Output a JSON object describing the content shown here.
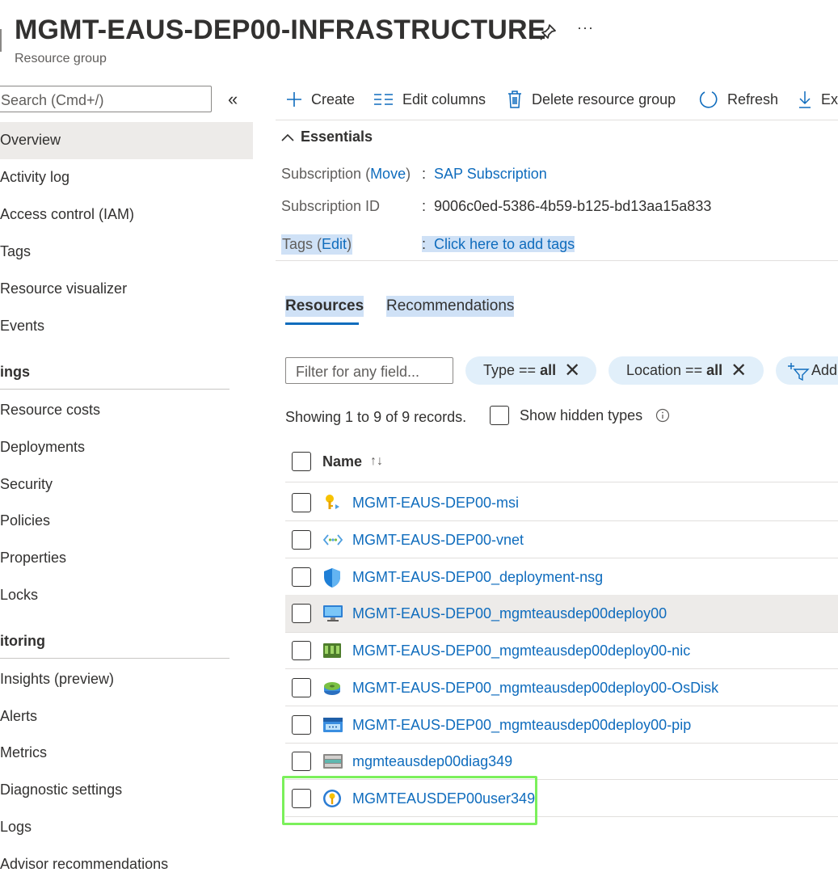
{
  "header": {
    "title": "MGMT-EAUS-DEP00-INFRASTRUCTURE",
    "subtitle": "Resource group",
    "more_label": "···"
  },
  "sidebar": {
    "search_placeholder": "Search (Cmd+/)",
    "collapse_label": "«",
    "items_top": [
      {
        "label": "Overview"
      },
      {
        "label": "Activity log"
      },
      {
        "label": "Access control (IAM)"
      },
      {
        "label": "Tags"
      },
      {
        "label": "Resource visualizer"
      },
      {
        "label": "Events"
      }
    ],
    "section_settings": "ings",
    "items_settings": [
      {
        "label": "Resource costs"
      },
      {
        "label": "Deployments"
      },
      {
        "label": "Security"
      },
      {
        "label": "Policies"
      },
      {
        "label": "Properties"
      },
      {
        "label": "Locks"
      }
    ],
    "section_monitoring": "itoring",
    "items_monitoring": [
      {
        "label": "Insights (preview)"
      },
      {
        "label": "Alerts"
      },
      {
        "label": "Metrics"
      },
      {
        "label": "Diagnostic settings"
      },
      {
        "label": "Logs"
      },
      {
        "label": "Advisor recommendations"
      }
    ]
  },
  "toolbar": {
    "create": "Create",
    "edit_columns": "Edit columns",
    "delete": "Delete resource group",
    "refresh": "Refresh",
    "export": "Ex"
  },
  "essentials": {
    "toggle_label": "Essentials",
    "subscription_label": "Subscription",
    "move_label": "Move",
    "subscription_value": "SAP Subscription",
    "subscription_id_label": "Subscription ID",
    "subscription_id_value": "9006c0ed-5386-4b59-b125-bd13aa15a833",
    "tags_label": "Tags",
    "edit_label": "Edit",
    "tags_value": "Click here to add tags",
    "sep": ":"
  },
  "tabs": {
    "resources": "Resources",
    "recommendations": "Recommendations"
  },
  "filters": {
    "placeholder": "Filter for any field...",
    "type_key": "Type == ",
    "type_value": "all",
    "location_key": "Location == ",
    "location_value": "all",
    "add_label": "Add"
  },
  "records_text": "Showing 1 to 9 of 9 records.",
  "show_hidden_label": "Show hidden types",
  "table": {
    "name_header": "Name",
    "sort_glyph": "↑↓",
    "rows": [
      {
        "name": "MGMT-EAUS-DEP00-msi",
        "icon": "managed-identity-icon"
      },
      {
        "name": "MGMT-EAUS-DEP00-vnet",
        "icon": "virtual-network-icon"
      },
      {
        "name": "MGMT-EAUS-DEP00_deployment-nsg",
        "icon": "network-security-group-icon"
      },
      {
        "name": "MGMT-EAUS-DEP00_mgmteausdep00deploy00",
        "icon": "virtual-machine-icon"
      },
      {
        "name": "MGMT-EAUS-DEP00_mgmteausdep00deploy00-nic",
        "icon": "network-interface-icon"
      },
      {
        "name": "MGMT-EAUS-DEP00_mgmteausdep00deploy00-OsDisk",
        "icon": "disk-icon"
      },
      {
        "name": "MGMT-EAUS-DEP00_mgmteausdep00deploy00-pip",
        "icon": "public-ip-icon"
      },
      {
        "name": "mgmteausdep00diag349",
        "icon": "storage-account-icon"
      },
      {
        "name": "MGMTEAUSDEP00user349",
        "icon": "key-vault-icon"
      }
    ]
  },
  "colors": {
    "link": "#0f6cbd",
    "highlight": "#cfe1f6",
    "pill": "#e1effa",
    "selected_row_outline": "#7bf05b"
  }
}
